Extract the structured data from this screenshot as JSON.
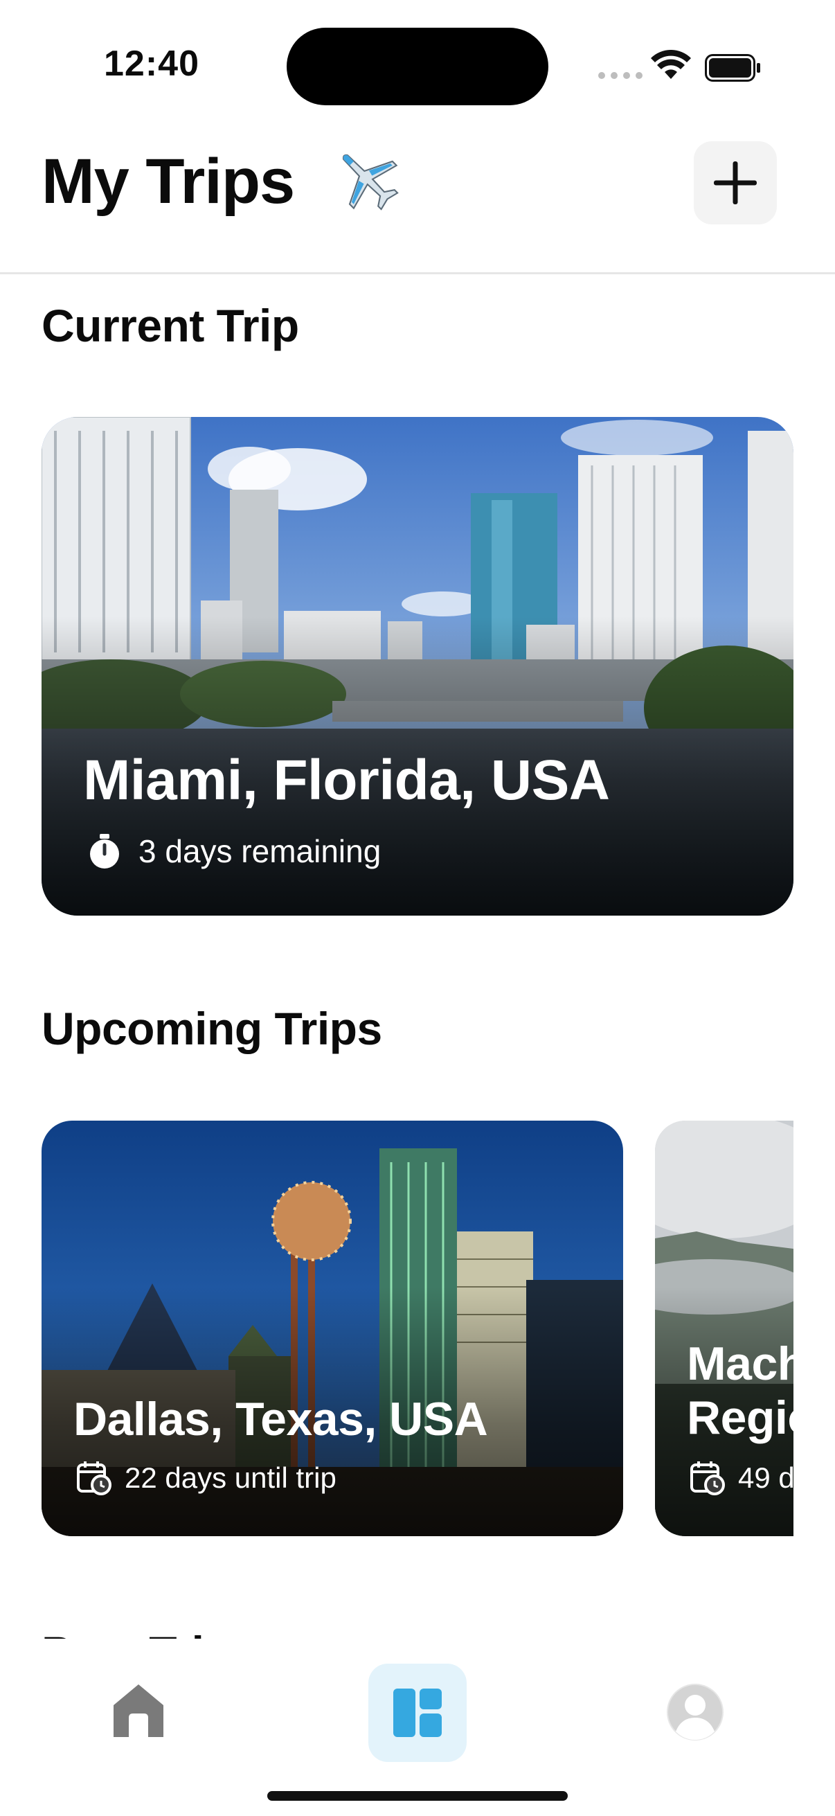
{
  "status_bar": {
    "time": "12:40"
  },
  "header": {
    "title": "My Trips",
    "title_emoji": "airplane-icon",
    "add_button_icon": "plus-icon"
  },
  "sections": {
    "current": "Current Trip",
    "upcoming": "Upcoming Trips",
    "past": "Past Trips"
  },
  "current_trip": {
    "destination": "Miami, Florida, USA",
    "status": "3 days remaining",
    "status_icon": "stopwatch-icon"
  },
  "upcoming_trips": [
    {
      "destination": "Dallas, Texas, USA",
      "status": "22 days until trip",
      "status_icon": "calendar-clock-icon"
    },
    {
      "destination_line1": "Mach",
      "destination_line2": "Regio",
      "status": "49 d",
      "status_icon": "calendar-clock-icon"
    }
  ],
  "tab_bar": {
    "items": [
      {
        "icon": "home-icon",
        "selected": false
      },
      {
        "icon": "dashboard-icon",
        "selected": true
      },
      {
        "icon": "profile-icon",
        "selected": false
      }
    ],
    "accent_color": "#35a8e0",
    "selected_bg": "#e3f3fb"
  }
}
